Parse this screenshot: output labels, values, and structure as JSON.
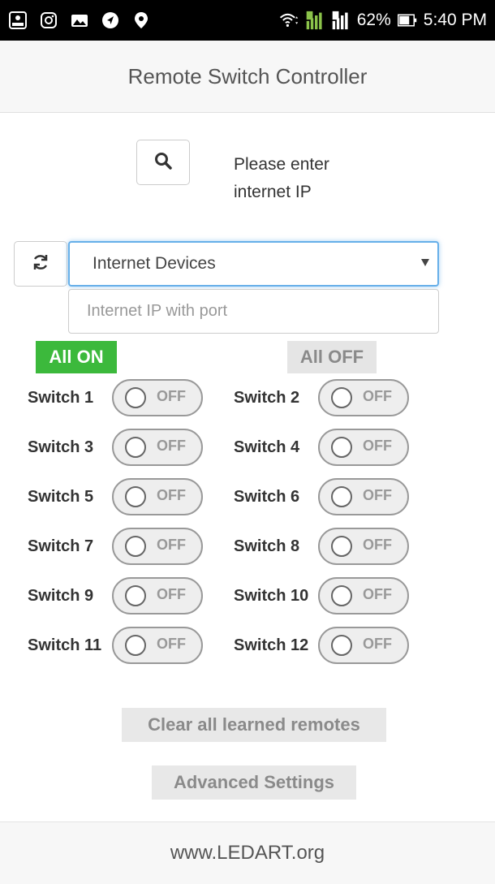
{
  "status_bar": {
    "icons": [
      "rec-icon",
      "instagram-icon",
      "gallery-icon",
      "navigation-icon",
      "location-pin-icon",
      "wifi-icon",
      "sim1-signal-icon",
      "sim2-signal-icon",
      "battery-icon"
    ],
    "battery": "62%",
    "time": "5:40 PM",
    "sim1": "1",
    "sim2": "2"
  },
  "header": {
    "title": "Remote Switch Controller"
  },
  "search": {
    "icon": "search-icon",
    "hint_line1": "Please enter",
    "hint_line2": "internet IP"
  },
  "device": {
    "refresh_icon": "refresh-icon",
    "selected": "Internet Devices",
    "ip_placeholder": "Internet IP with port",
    "ip_value": ""
  },
  "controls": {
    "all_on": "All ON",
    "all_off": "All OFF"
  },
  "switches": [
    {
      "label": "Switch 1",
      "state": "OFF"
    },
    {
      "label": "Switch 2",
      "state": "OFF"
    },
    {
      "label": "Switch 3",
      "state": "OFF"
    },
    {
      "label": "Switch 4",
      "state": "OFF"
    },
    {
      "label": "Switch 5",
      "state": "OFF"
    },
    {
      "label": "Switch 6",
      "state": "OFF"
    },
    {
      "label": "Switch 7",
      "state": "OFF"
    },
    {
      "label": "Switch 8",
      "state": "OFF"
    },
    {
      "label": "Switch 9",
      "state": "OFF"
    },
    {
      "label": "Switch 10",
      "state": "OFF"
    },
    {
      "label": "Switch 11",
      "state": "OFF"
    },
    {
      "label": "Switch 12",
      "state": "OFF"
    }
  ],
  "actions": {
    "clear_remotes": "Clear all learned remotes",
    "advanced_settings": "Advanced Settings"
  },
  "footer": {
    "text": "www.LEDART.org"
  },
  "colors": {
    "all_on_bg": "#3cb93c",
    "focus_border": "#66afe9",
    "status_bar_bg": "#000000",
    "signal_green": "#8bc34a"
  }
}
